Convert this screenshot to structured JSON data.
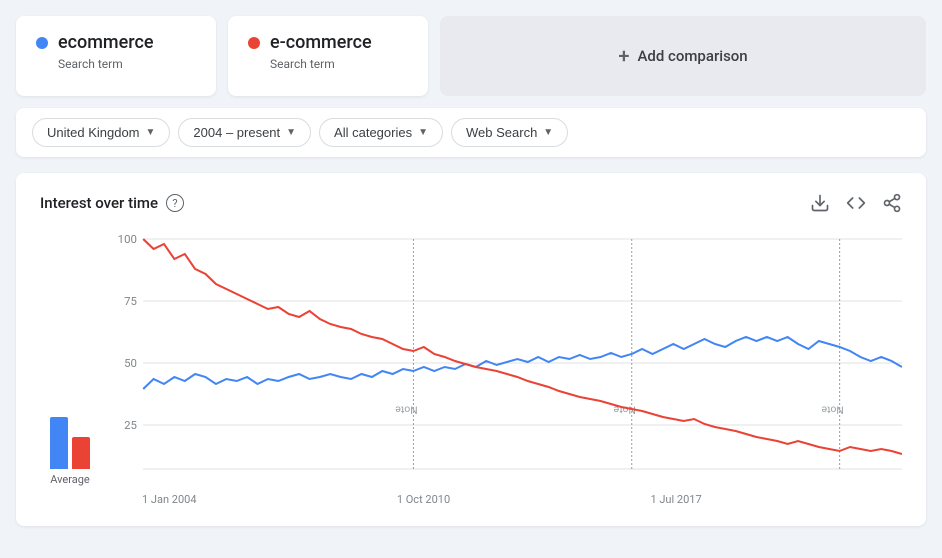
{
  "search_terms": [
    {
      "id": "term1",
      "label": "ecommerce",
      "type": "Search term",
      "dot_class": "dot-blue"
    },
    {
      "id": "term2",
      "label": "e-commerce",
      "type": "Search term",
      "dot_class": "dot-red"
    }
  ],
  "add_comparison": {
    "label": "Add comparison"
  },
  "filters": [
    {
      "id": "location",
      "label": "United Kingdom"
    },
    {
      "id": "time",
      "label": "2004 – present"
    },
    {
      "id": "category",
      "label": "All categories"
    },
    {
      "id": "search_type",
      "label": "Web Search"
    }
  ],
  "chart": {
    "title": "Interest over time",
    "help_label": "?",
    "actions": {
      "download": "⬇",
      "embed": "<>",
      "share": "share"
    },
    "y_labels": [
      "100",
      "75",
      "50",
      "25"
    ],
    "x_labels": [
      "1 Jan 2004",
      "1 Oct 2010",
      "1 Jul 2017"
    ],
    "note_labels": [
      "Note",
      "Note",
      "Note"
    ],
    "average_label": "Average",
    "colors": {
      "blue": "#4285f4",
      "red": "#ea4335",
      "grid": "#e0e0e0",
      "note_line": "#9aa0a6"
    }
  }
}
